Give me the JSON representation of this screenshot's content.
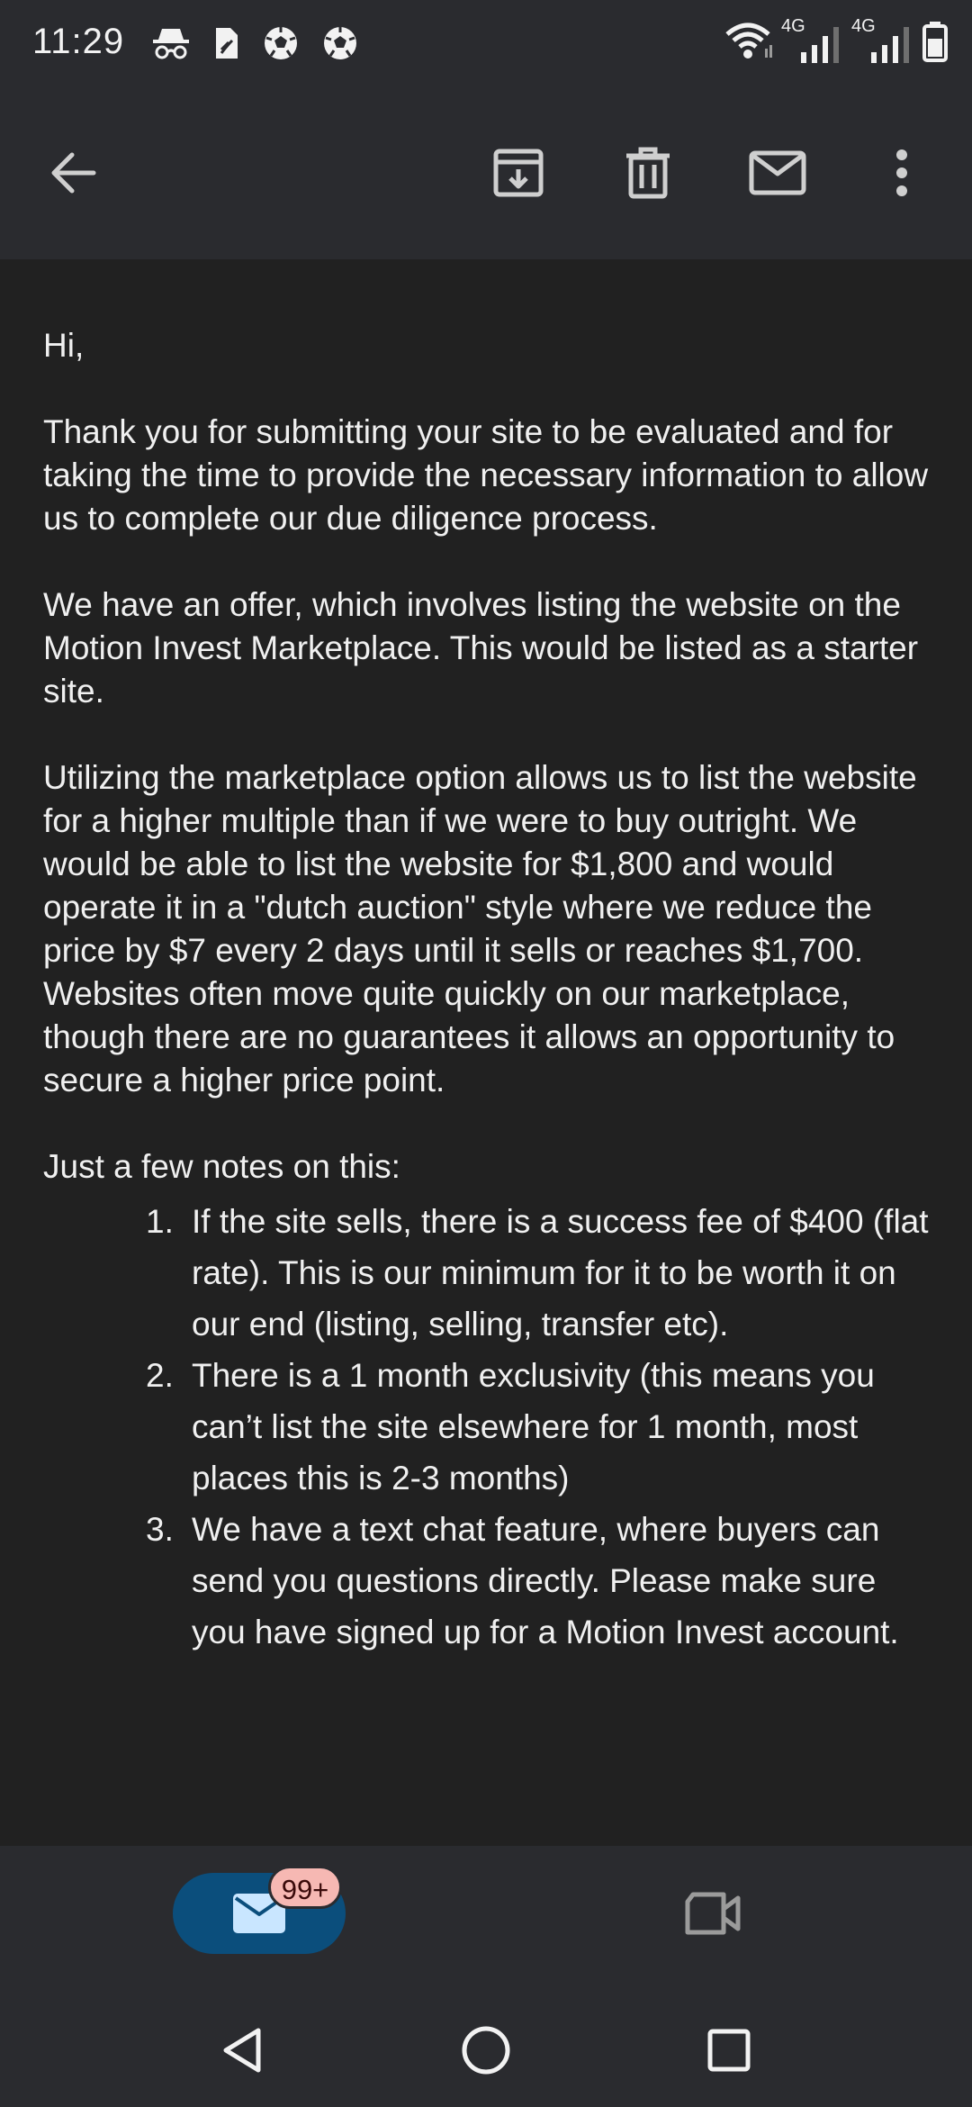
{
  "status_bar": {
    "time": "11:29",
    "left_icons": [
      "incognito-icon",
      "sim-card-icon",
      "soccer-ball-icon",
      "soccer-ball-icon"
    ],
    "right_icons": [
      "wifi-icon",
      "signal-4g-icon",
      "signal-4g-icon",
      "battery-icon"
    ],
    "network_label_1": "4G",
    "network_label_2": "4G"
  },
  "app_bar": {
    "icons": [
      "back-arrow-icon",
      "archive-icon",
      "delete-icon",
      "mark-unread-icon",
      "more-vert-icon"
    ]
  },
  "email": {
    "greeting": "Hi,",
    "paragraph_1": "Thank you for submitting your site to be evaluated and for taking the time to provide the necessary information to allow us to complete our due diligence process.",
    "paragraph_2": "We have an offer, which involves listing the website on the Motion Invest Marketplace. This would be listed as a starter site.",
    "paragraph_3": "Utilizing the marketplace option allows us to list the website for a higher multiple than if we were to buy outright. We would be able to list the website for $1,800 and would operate it in a \"dutch auction\" style where we reduce the price by $7 every 2 days until it sells or reaches $1,700. Websites often move quite quickly on our marketplace, though there are no guarantees it allows an opportunity to secure a higher price point.",
    "notes_intro": "Just a few notes on this:",
    "notes": [
      {
        "num": "1.",
        "text": "If the site sells, there is a success fee of $400 (flat rate). This is our minimum for it to be worth it on our end (listing, selling, transfer etc)."
      },
      {
        "num": "2.",
        "text": "There is a 1 month exclusivity (this means you can’t list the site elsewhere for 1 month, most places this is 2-3 months)"
      },
      {
        "num": "3.",
        "text": "We have a text chat feature, where buyers can send you questions directly. Please make sure you have signed up for a Motion Invest account."
      }
    ]
  },
  "bottom_nav": {
    "mail_badge": "99+",
    "icons": [
      "mail-icon",
      "video-camera-icon"
    ]
  },
  "system_nav": {
    "icons": [
      "nav-back-icon",
      "nav-home-icon",
      "nav-recents-icon"
    ]
  },
  "colors": {
    "background": "#212121",
    "bar": "#2a2b2f",
    "mail_pill": "#0b4e7c",
    "badge": "#f6b8b3"
  }
}
